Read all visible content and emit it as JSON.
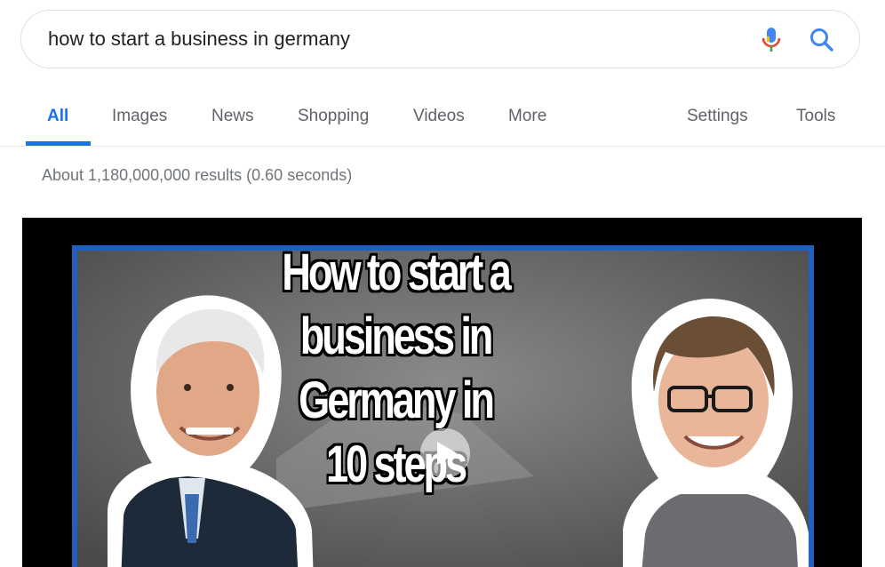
{
  "search": {
    "query": "how to start a business in germany",
    "mic_icon": "mic-icon",
    "search_icon": "search-icon"
  },
  "tabs": {
    "items": [
      {
        "label": "All",
        "active": true
      },
      {
        "label": "Images"
      },
      {
        "label": "News"
      },
      {
        "label": "Shopping"
      },
      {
        "label": "Videos"
      },
      {
        "label": "More"
      }
    ],
    "settings_label": "Settings",
    "tools_label": "Tools"
  },
  "results": {
    "stats": "About 1,180,000,000 results (0.60 seconds)"
  },
  "video": {
    "title_lines": [
      "How to start a",
      "business in",
      "Germany in",
      "10 steps"
    ],
    "play_icon": "play-icon"
  },
  "colors": {
    "accent": "#1a73e8",
    "tab_text": "#5f6368",
    "stats_text": "#70757a",
    "frame_border": "#1f5fbf"
  }
}
